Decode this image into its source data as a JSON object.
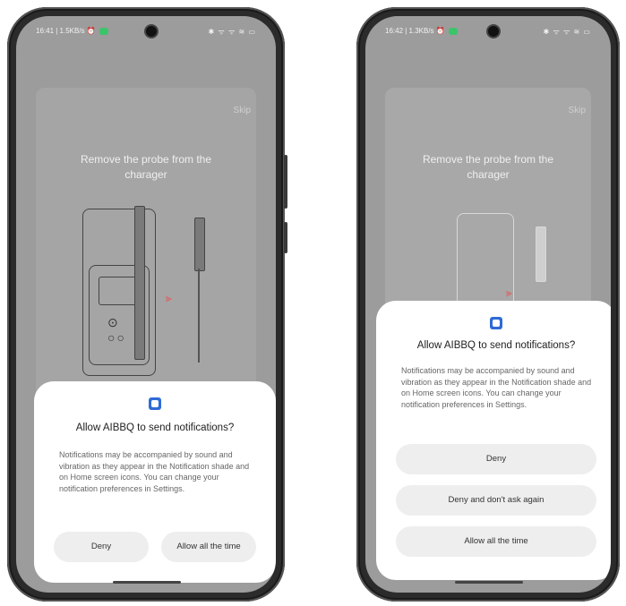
{
  "left_phone": {
    "status_time": "16:41 | 1.5KB/s",
    "status_icons": "✱ ᯤ ᯤ ≋ ▭",
    "skip_label": "Skip",
    "instruction": "Remove the probe from the charager",
    "dialog": {
      "icon": "app-icon",
      "title": "Allow AIBBQ to send notifications?",
      "body": "Notifications may be accompanied by sound and vibration as they appear in the Notification shade and on Home screen icons. You can change your notification preferences in Settings.",
      "buttons": [
        "Deny",
        "Allow all the time"
      ]
    }
  },
  "right_phone": {
    "status_time": "16:42 | 1.3KB/s",
    "status_icons": "✱ ᯤ ᯤ ≋ ▭",
    "skip_label": "Skip",
    "instruction": "Remove the probe from the charager",
    "dialog": {
      "icon": "app-icon",
      "title": "Allow AIBBQ to send notifications?",
      "body": "Notifications may be accompanied by sound and vibration as they appear in the Notification shade and on Home screen icons. You can change your notification preferences in Settings.",
      "buttons": [
        "Deny",
        "Deny and don't ask again",
        "Allow all the time"
      ]
    }
  },
  "colors": {
    "accent": "#2e6bd6",
    "status_app": "#3cc46a",
    "arrow": "#e05a5a"
  }
}
